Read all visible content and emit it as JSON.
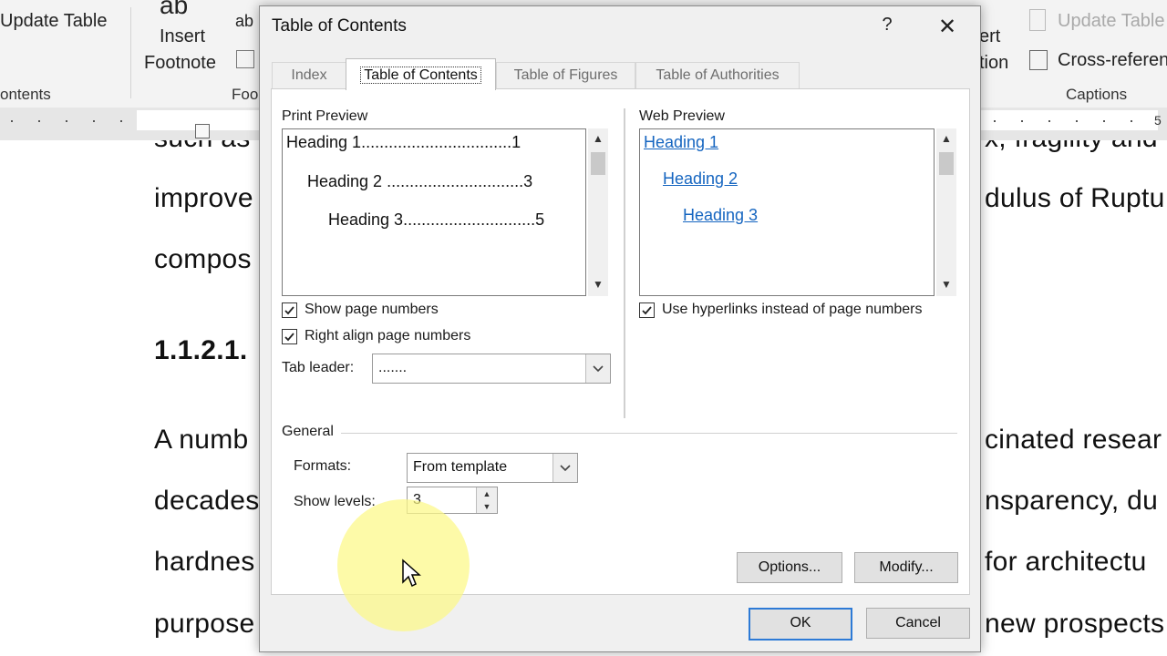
{
  "ribbon": {
    "update_table": "Update Table",
    "contents_group": "ontents",
    "insert_footnote_ab": "ab",
    "insert_label": "Insert",
    "footnote_label": "Footnote",
    "ab_small": "ab",
    "footnotes_group": "Foo",
    "insert_caption_1": "ert",
    "insert_caption_2": "tion",
    "update_table_right": "Update Table",
    "cross_reference": "Cross-referen",
    "captions_group": "Captions"
  },
  "ruler": {
    "number": "5"
  },
  "document": {
    "lines": [
      {
        "left": "such as",
        "right": "x, fragility and"
      },
      {
        "left": "improve",
        "right": "dulus of Ruptu"
      },
      {
        "left": "compos",
        "right": ""
      },
      {
        "left": "1.1.2.1.",
        "right": ""
      },
      {
        "left": "A numb",
        "right": "cinated resear"
      },
      {
        "left": "decades",
        "right": "nsparency, du"
      },
      {
        "left": "hardnes",
        "right": "for architectu"
      },
      {
        "left": "purpose",
        "right": "new prospects"
      }
    ]
  },
  "dialog": {
    "title": "Table of Contents",
    "help": "?",
    "close": "✕",
    "tabs": [
      {
        "label": "Index",
        "active": false
      },
      {
        "label": "Table of Contents",
        "active": true
      },
      {
        "label": "Table of Figures",
        "active": false
      },
      {
        "label": "Table of Authorities",
        "active": false
      }
    ],
    "print_preview": {
      "label": "Print Preview",
      "entries": [
        "Heading 1.................................1",
        "Heading 2 ..............................3",
        "Heading 3.............................5"
      ]
    },
    "web_preview": {
      "label": "Web Preview",
      "links": [
        "Heading 1",
        "Heading 2",
        "Heading 3"
      ]
    },
    "show_page_numbers": {
      "label": "Show page numbers",
      "checked": true
    },
    "right_align": {
      "label": "Right align page numbers",
      "checked": true
    },
    "tab_leader": {
      "label": "Tab leader:",
      "value": "......."
    },
    "use_hyperlinks": {
      "label": "Use hyperlinks instead of page numbers",
      "checked": true
    },
    "general": {
      "label": "General",
      "formats_label": "Formats:",
      "formats_value": "From template",
      "levels_label": "Show levels:",
      "levels_value": "3"
    },
    "buttons": {
      "options": "Options...",
      "modify": "Modify...",
      "ok": "OK",
      "cancel": "Cancel"
    }
  },
  "colors": {
    "link": "#1565c0",
    "default_button_border": "#2d7ad6",
    "cursor_highlight": "#fcf887"
  },
  "icons": [
    "close-icon",
    "help-icon",
    "chevron-down-icon",
    "spin-up-icon",
    "spin-down-icon",
    "mouse-cursor-icon",
    "checkmark-icon"
  ]
}
